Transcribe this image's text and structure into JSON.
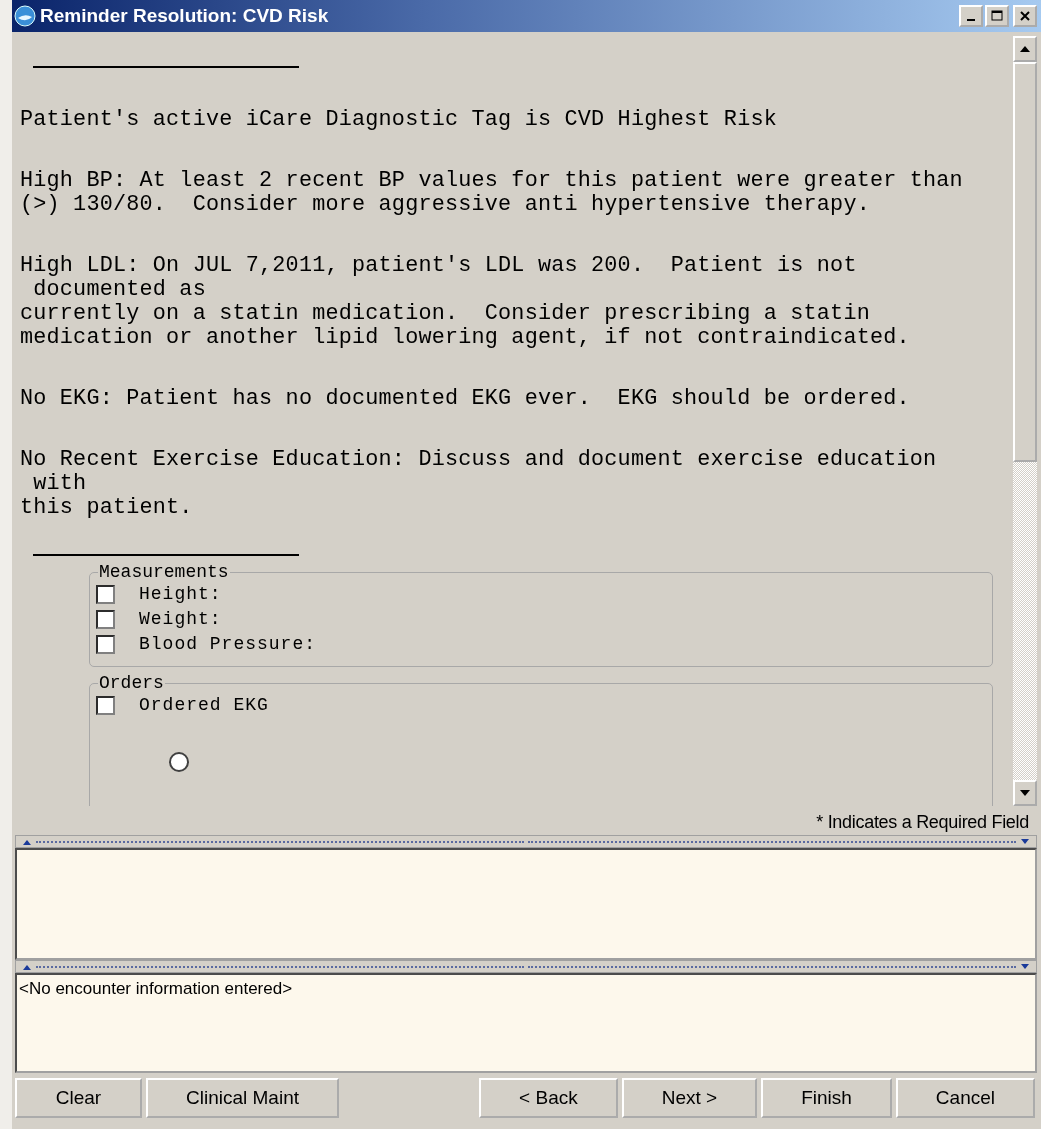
{
  "window": {
    "title": "Reminder Resolution: CVD Risk"
  },
  "paragraphs": [
    {
      "lines": [
        "Patient's active iCare Diagnostic Tag is CVD Highest Risk"
      ]
    },
    {
      "lines": [
        "High BP: At least 2 recent BP values for this patient were greater than",
        "(>) 130/80.  Consider more aggressive anti hypertensive therapy."
      ]
    },
    {
      "lines": [
        "High LDL: On JUL 7,2011, patient's LDL was 200.  Patient is not",
        " documented as",
        "currently on a statin medication.  Consider prescribing a statin",
        "medication or another lipid lowering agent, if not contraindicated."
      ]
    },
    {
      "lines": [
        "No EKG: Patient has no documented EKG ever.  EKG should be ordered."
      ]
    },
    {
      "lines": [
        "No Recent Exercise Education: Discuss and document exercise education",
        " with",
        "this patient."
      ]
    }
  ],
  "groups": [
    {
      "title": "Measurements",
      "items": [
        {
          "kind": "checkbox",
          "label": "Height:",
          "checked": false
        },
        {
          "kind": "checkbox",
          "label": "Weight:",
          "checked": false
        },
        {
          "kind": "checkbox",
          "label": "Blood Pressure:",
          "checked": false
        }
      ]
    },
    {
      "title": "Orders",
      "items": [
        {
          "kind": "checkbox",
          "label": "Ordered EKG",
          "checked": false
        },
        {
          "kind": "radio",
          "selected": false
        }
      ]
    }
  ],
  "required_note": "* Indicates a Required Field",
  "encounter_text": "<No encounter information entered>",
  "left_buttons": [
    {
      "label": "Clear"
    },
    {
      "label": "Clinical Maint"
    }
  ],
  "right_buttons": [
    {
      "label": "< Back"
    },
    {
      "label": "Next >"
    },
    {
      "label": "Finish"
    },
    {
      "label": "Cancel"
    }
  ]
}
